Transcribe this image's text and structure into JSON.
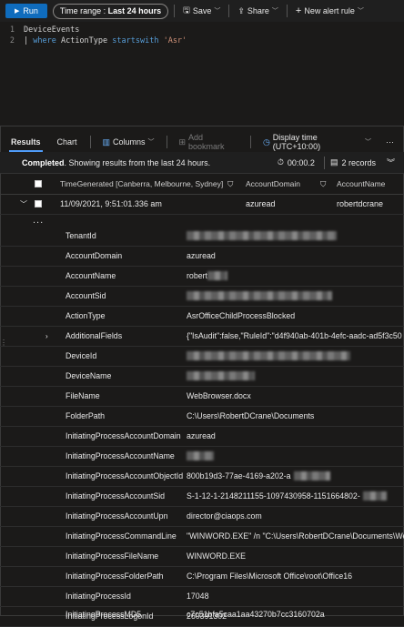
{
  "toolbar": {
    "run_label": "Run",
    "time_range_label": "Time range :",
    "time_range_value": "Last 24 hours",
    "save_label": "Save",
    "share_label": "Share",
    "new_alert_label": "New alert rule"
  },
  "editor": {
    "lines": [
      {
        "num": "1",
        "text": "DeviceEvents"
      },
      {
        "num": "2",
        "pipe": "| ",
        "kw": "where",
        "rest": " ActionType ",
        "kw2": "startswith",
        "space": " ",
        "str": "'Asr'"
      }
    ]
  },
  "tabs": {
    "results": "Results",
    "chart": "Chart",
    "columns": "Columns",
    "add_bookmark": "Add bookmark",
    "display_time": "Display time (UTC+10:00)"
  },
  "status": {
    "completed": "Completed",
    "message": ". Showing results from the last 24 hours.",
    "duration": "00:00.2",
    "records": "2 records"
  },
  "grid": {
    "headers": [
      "TimeGenerated [Canberra, Melbourne, Sydney]",
      "AccountDomain",
      "AccountName"
    ],
    "row": {
      "time": "11/09/2021, 9:51:01.336 am",
      "domain": "azuread",
      "name": "robertdcrane"
    },
    "ellipsis": "...",
    "details": [
      {
        "key": "TenantId",
        "value": ""
      },
      {
        "key": "AccountDomain",
        "value": "azuread"
      },
      {
        "key": "AccountName",
        "value": "robert"
      },
      {
        "key": "AccountSid",
        "value": ""
      },
      {
        "key": "ActionType",
        "value": "AsrOfficeChildProcessBlocked"
      },
      {
        "key": "AdditionalFields",
        "value": "{\"IsAudit\":false,\"RuleId\":\"d4f940ab-401b-4efc-aadc-ad5f3c50"
      },
      {
        "key": "DeviceId",
        "value": ""
      },
      {
        "key": "DeviceName",
        "value": ""
      },
      {
        "key": "FileName",
        "value": "WebBrowser.docx"
      },
      {
        "key": "FolderPath",
        "value": "C:\\Users\\RobertDCrane\\Documents"
      },
      {
        "key": "InitiatingProcessAccountDomain",
        "value": "azuread"
      },
      {
        "key": "InitiatingProcessAccountName",
        "value": ""
      },
      {
        "key": "InitiatingProcessAccountObjectId",
        "value": "800b19d3-77ae-4169-a202-a"
      },
      {
        "key": "InitiatingProcessAccountSid",
        "value": "S-1-12-1-2148211155-1097430958-1151664802-"
      },
      {
        "key": "InitiatingProcessAccountUpn",
        "value": "director@ciaops.com"
      },
      {
        "key": "InitiatingProcessCommandLine",
        "value": "\"WINWORD.EXE\" /n \"C:\\Users\\RobertDCrane\\Documents\\We"
      },
      {
        "key": "InitiatingProcessFileName",
        "value": "WINWORD.EXE"
      },
      {
        "key": "InitiatingProcessFolderPath",
        "value": "C:\\Program Files\\Microsoft Office\\root\\Office16"
      },
      {
        "key": "InitiatingProcessId",
        "value": "17048"
      },
      {
        "key": "InitiatingProcessLogonId",
        "value": "260391302"
      },
      {
        "key": "InitiatingProcessMD5",
        "value": "c7c51bfa5caa1aa43270b7cc3160702a"
      }
    ]
  }
}
